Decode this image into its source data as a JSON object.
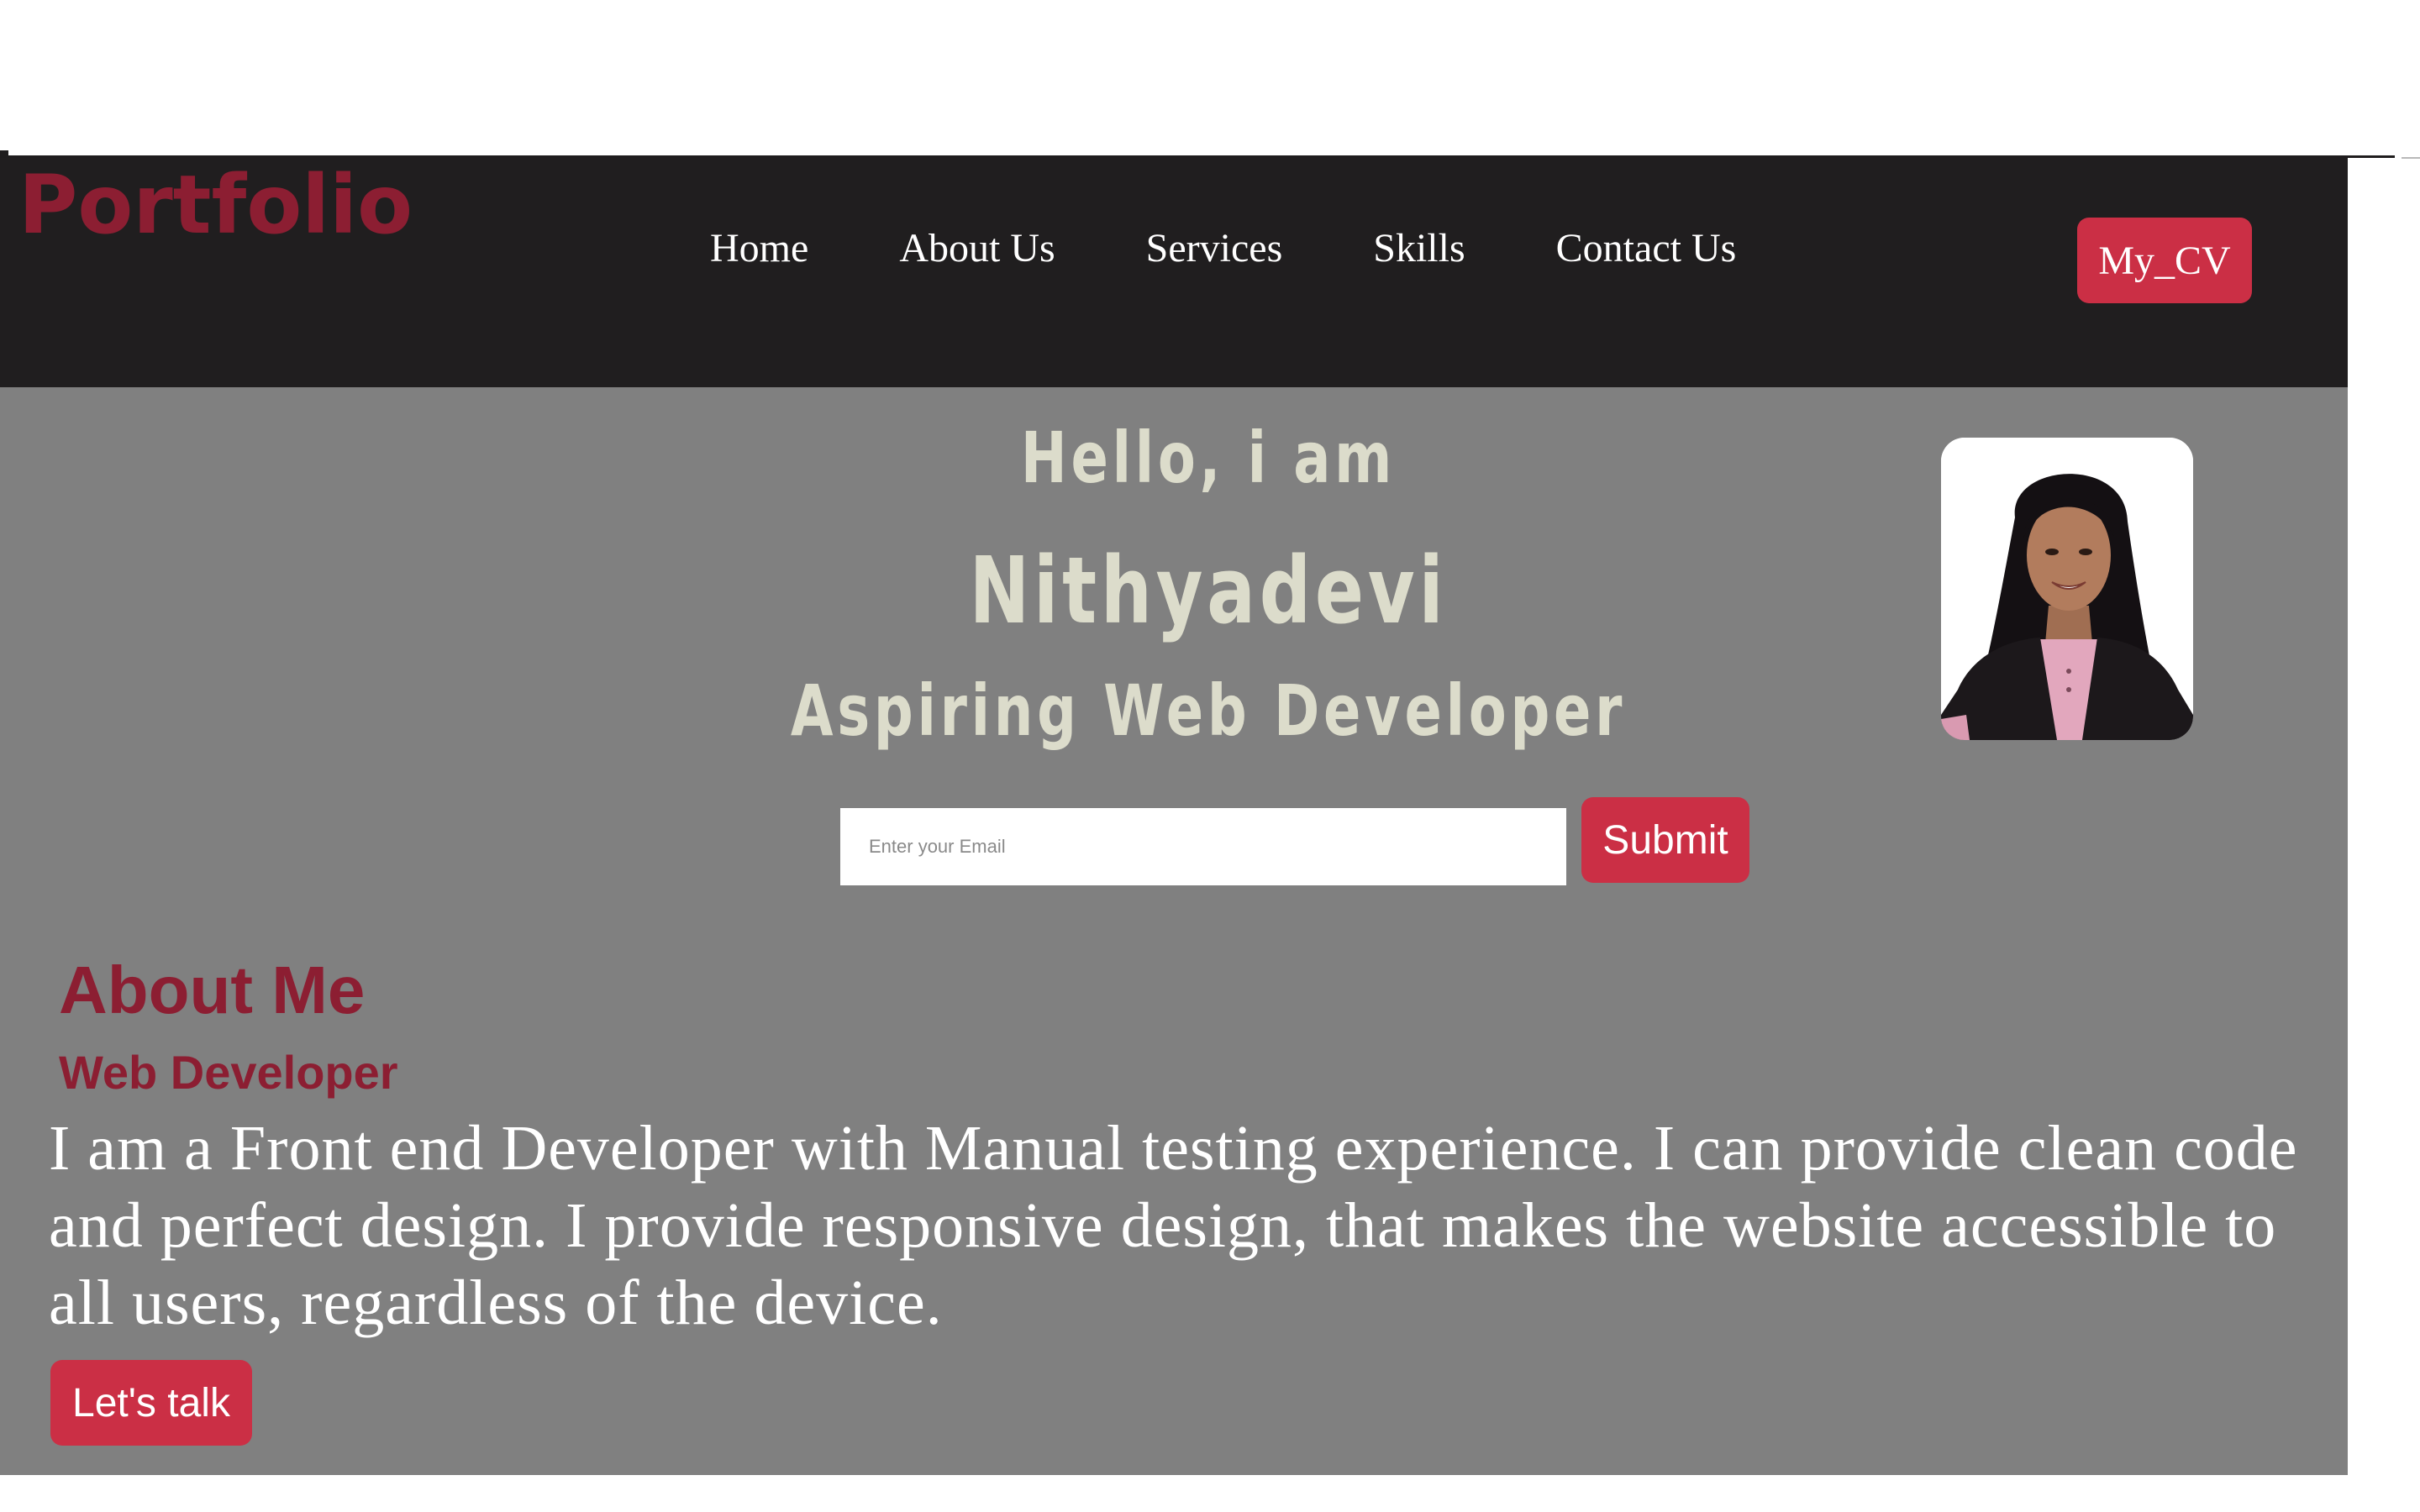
{
  "header": {
    "logo": "Portfolio",
    "nav": [
      "Home",
      "About Us",
      "Services",
      "Skills",
      "Contact Us"
    ],
    "cv_label": "My_CV"
  },
  "hero": {
    "greeting": "Hello, i am",
    "name": "Nithyadevi",
    "role": "Aspiring Web Developer",
    "email_placeholder": "Enter your Email",
    "submit_label": "Submit"
  },
  "about": {
    "title": "About Me",
    "subtitle": "Web Developer",
    "body": "I am a Front end Developer with Manual testing experience. I can provide clean code and perfect design. I provide responsive design, that makes the website accessible to all users, regardless of the device.",
    "cta_label": "Let's talk"
  },
  "colors": {
    "header_bg": "#201e1f",
    "main_bg": "#808080",
    "brand": "#8c1e32",
    "button": "#cb2f45",
    "hero_text": "#dcdccb"
  }
}
